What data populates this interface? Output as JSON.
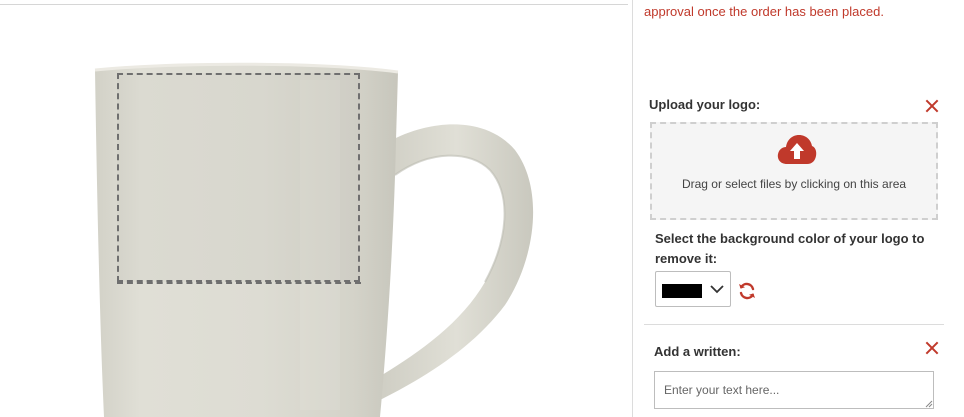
{
  "notice": {
    "approval_text": "approval once the order has been placed."
  },
  "upload": {
    "label": "Upload your logo:",
    "dropzone_text": "Drag or select files by clicking on this area",
    "icon": "cloud-upload-icon"
  },
  "background_color": {
    "label": "Select the background color of your logo to remove it:",
    "selected_color": "#000000"
  },
  "written": {
    "label": "Add a written:",
    "placeholder": "Enter your text here..."
  },
  "colors": {
    "accent": "#c0392b",
    "mug": "#dcdbd2"
  }
}
